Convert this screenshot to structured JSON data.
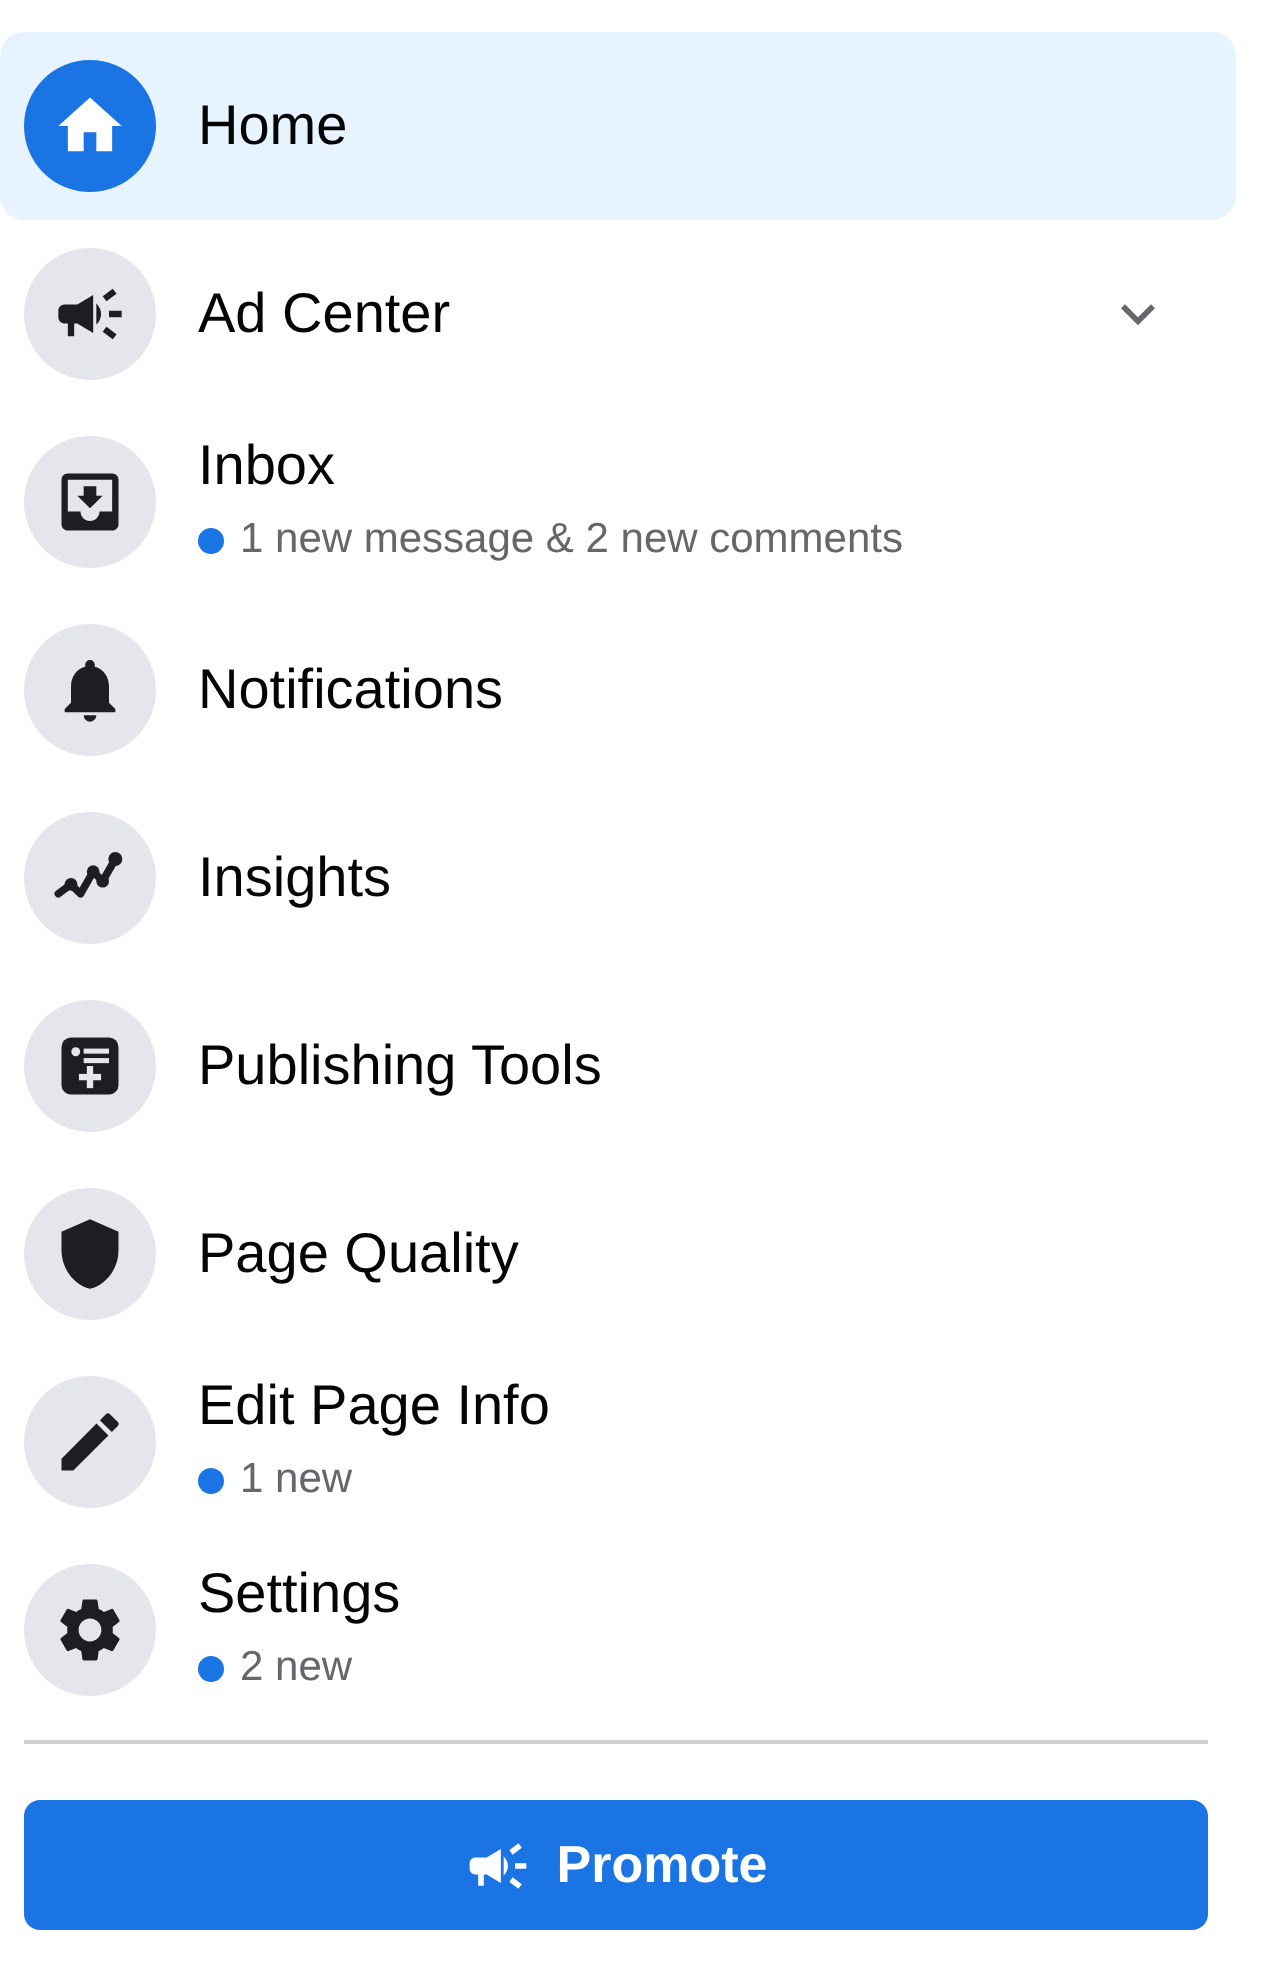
{
  "menu": {
    "items": [
      {
        "label": "Home",
        "selected": true
      },
      {
        "label": "Ad Center",
        "selected": false,
        "expanded": false
      },
      {
        "label": "Inbox",
        "selected": false,
        "subtitle": "1 new message & 2 new comments"
      },
      {
        "label": "Notifications",
        "selected": false
      },
      {
        "label": "Insights",
        "selected": false
      },
      {
        "label": "Publishing Tools",
        "selected": false
      },
      {
        "label": "Page Quality",
        "selected": false
      },
      {
        "label": "Edit Page Info",
        "selected": false,
        "subtitle": "1 new"
      },
      {
        "label": "Settings",
        "selected": false,
        "subtitle": "2 new"
      }
    ]
  },
  "promote_button": {
    "label": "Promote"
  }
}
